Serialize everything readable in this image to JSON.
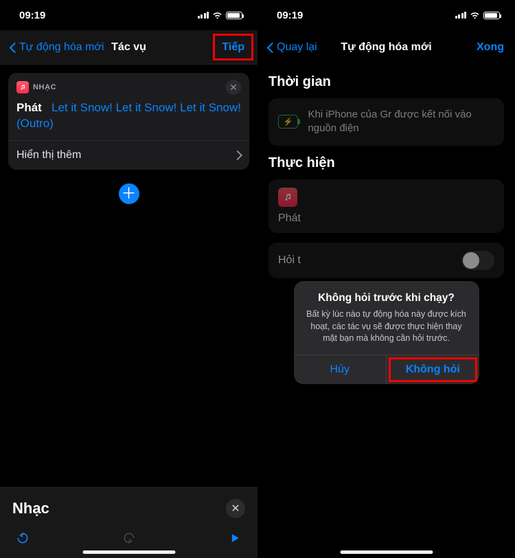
{
  "status": {
    "time": "09:19"
  },
  "left": {
    "nav": {
      "back_label": "Tự động hóa mới",
      "title": "Tác vụ",
      "next": "Tiếp"
    },
    "card": {
      "app_badge": "NHẠC",
      "action_label": "Phát",
      "song_title": "Let it Snow! Let it Snow! Let it Snow! (Outro)",
      "show_more": "Hiển thị thêm"
    },
    "sheet": {
      "title": "Nhạc"
    }
  },
  "right": {
    "nav": {
      "back_label": "Quay lại",
      "title": "Tự động hóa mới",
      "done": "Xong"
    },
    "time_section": "Thời gian",
    "time_desc": "Khi iPhone của Gr được kết nối vào nguồn điện",
    "perform_section": "Thực hiện",
    "perform_label": "Phát",
    "ask_label_partial": "Hỏi t",
    "alert": {
      "title": "Không hỏi trước khi chạy?",
      "message": "Bất kỳ lúc nào tự động hóa này được kích hoạt, các tác vụ sẽ được thực hiện thay mặt bạn mà không cần hỏi trước.",
      "cancel": "Hủy",
      "confirm": "Không hỏi"
    }
  }
}
